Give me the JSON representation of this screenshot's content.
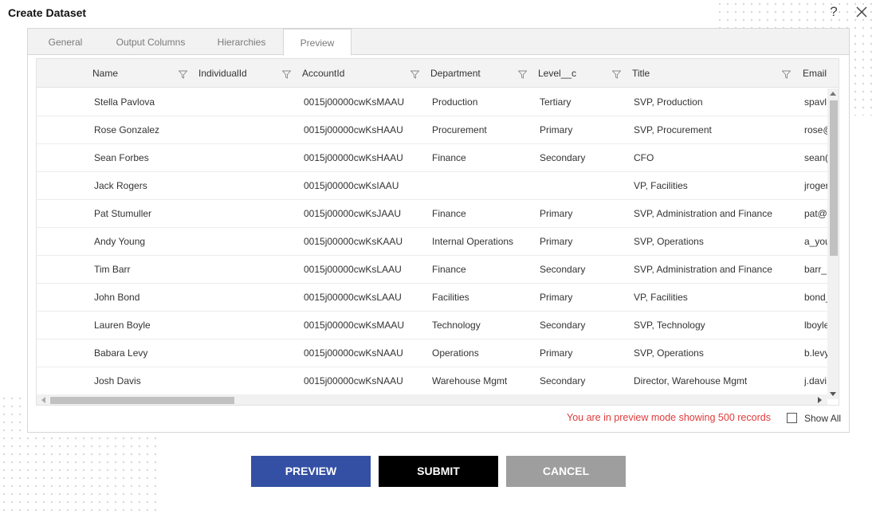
{
  "dialog": {
    "title": "Create Dataset",
    "help_symbol": "?"
  },
  "tabs": [
    {
      "label": "General"
    },
    {
      "label": "Output Columns"
    },
    {
      "label": "Hierarchies"
    },
    {
      "label": "Preview",
      "active": true
    }
  ],
  "grid": {
    "columns": [
      "Name",
      "IndividualId",
      "AccountId",
      "Department",
      "Level__c",
      "Title",
      "Email"
    ],
    "rows": [
      {
        "name": "Stella Pavlova",
        "individualId": "",
        "accountId": "0015j00000cwKsMAAU",
        "department": "Production",
        "level": "Tertiary",
        "title": "SVP, Production",
        "email": "spavl"
      },
      {
        "name": "Rose Gonzalez",
        "individualId": "",
        "accountId": "0015j00000cwKsHAAU",
        "department": "Procurement",
        "level": "Primary",
        "title": "SVP, Procurement",
        "email": "rose@"
      },
      {
        "name": "Sean Forbes",
        "individualId": "",
        "accountId": "0015j00000cwKsHAAU",
        "department": "Finance",
        "level": "Secondary",
        "title": "CFO",
        "email": "sean("
      },
      {
        "name": "Jack Rogers",
        "individualId": "",
        "accountId": "0015j00000cwKsIAAU",
        "department": "",
        "level": "",
        "title": "VP, Facilities",
        "email": "jroger"
      },
      {
        "name": "Pat Stumuller",
        "individualId": "",
        "accountId": "0015j00000cwKsJAAU",
        "department": "Finance",
        "level": "Primary",
        "title": "SVP, Administration and Finance",
        "email": "pat@"
      },
      {
        "name": "Andy Young",
        "individualId": "",
        "accountId": "0015j00000cwKsKAAU",
        "department": "Internal Operations",
        "level": "Primary",
        "title": "SVP, Operations",
        "email": "a_you"
      },
      {
        "name": "Tim Barr",
        "individualId": "",
        "accountId": "0015j00000cwKsLAAU",
        "department": "Finance",
        "level": "Secondary",
        "title": "SVP, Administration and Finance",
        "email": "barr_"
      },
      {
        "name": "John Bond",
        "individualId": "",
        "accountId": "0015j00000cwKsLAAU",
        "department": "Facilities",
        "level": "Primary",
        "title": "VP, Facilities",
        "email": "bond_"
      },
      {
        "name": "Lauren Boyle",
        "individualId": "",
        "accountId": "0015j00000cwKsMAAU",
        "department": "Technology",
        "level": "Secondary",
        "title": "SVP, Technology",
        "email": "lboyle"
      },
      {
        "name": "Babara Levy",
        "individualId": "",
        "accountId": "0015j00000cwKsNAAU",
        "department": "Operations",
        "level": "Primary",
        "title": "SVP, Operations",
        "email": "b.levy"
      },
      {
        "name": "Josh Davis",
        "individualId": "",
        "accountId": "0015j00000cwKsNAAU",
        "department": "Warehouse Mgmt",
        "level": "Secondary",
        "title": "Director, Warehouse Mgmt",
        "email": "j.davi"
      }
    ]
  },
  "footer": {
    "preview_message": "You are in preview mode showing 500 records",
    "show_all_label": "Show All",
    "show_all_checked": false
  },
  "buttons": {
    "preview": "PREVIEW",
    "submit": "SUBMIT",
    "cancel": "CANCEL"
  },
  "colors": {
    "accent": "#3450a4",
    "message": "#e03b3b",
    "cancel": "#9e9e9e"
  }
}
